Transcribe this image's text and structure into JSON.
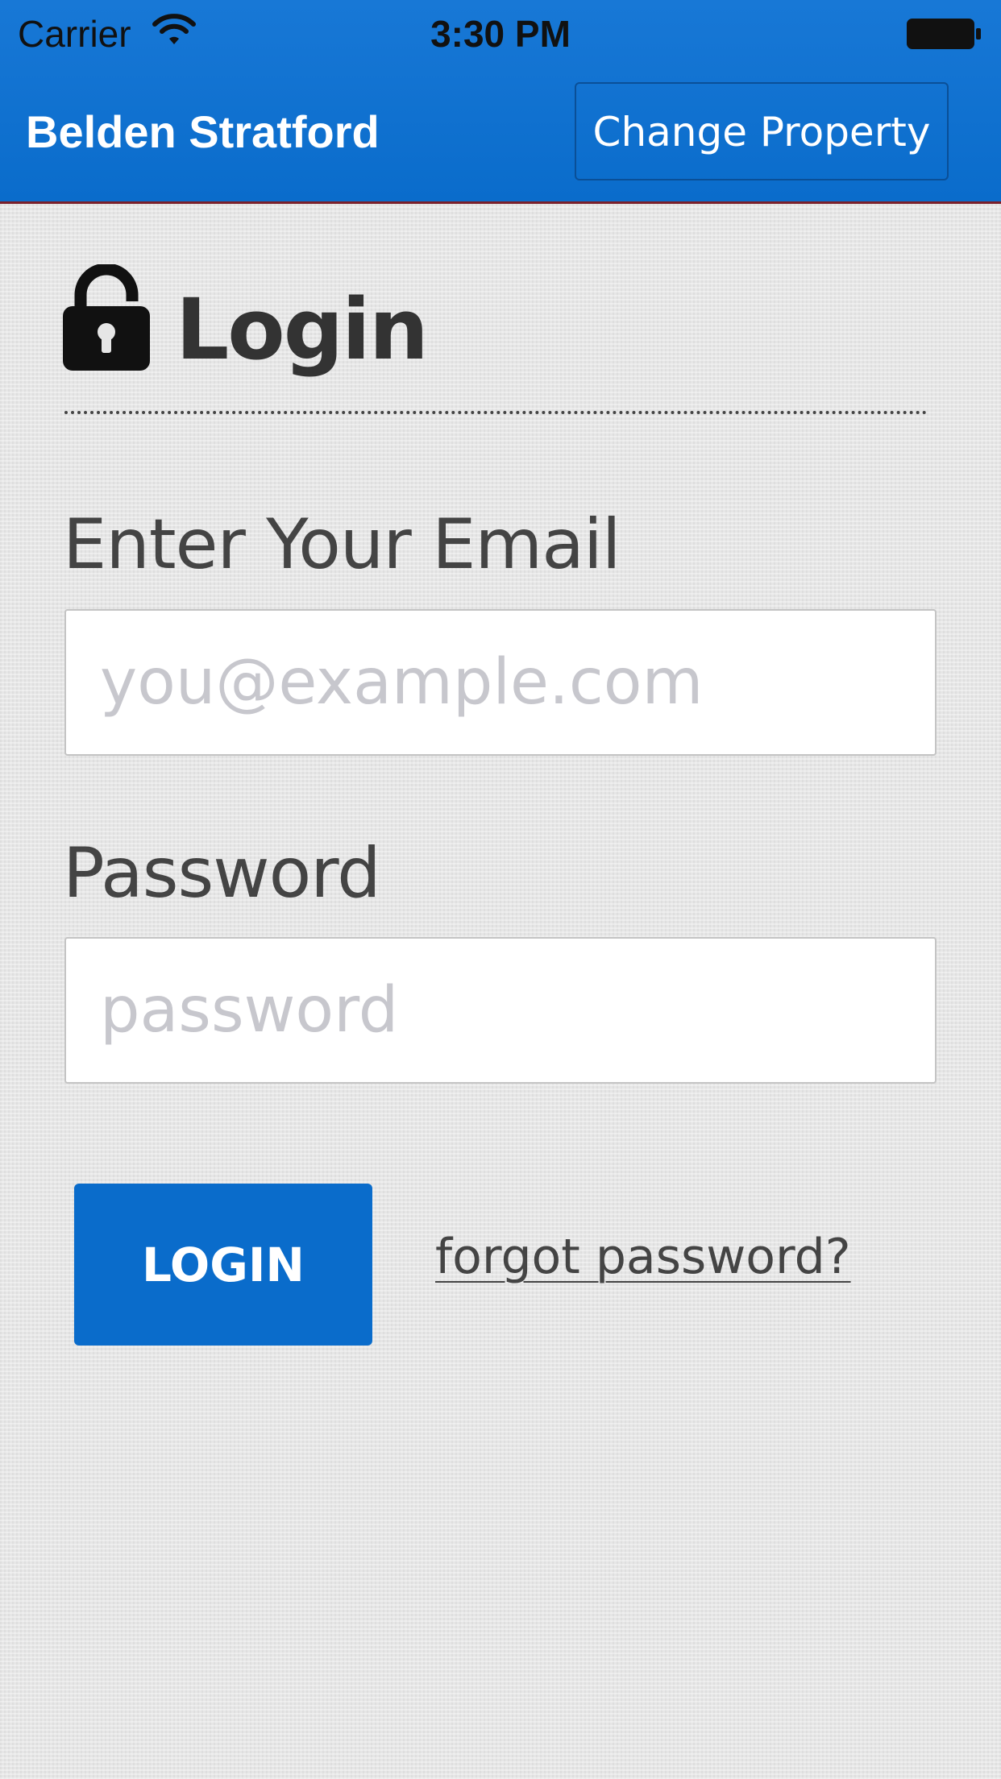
{
  "status_bar": {
    "carrier": "Carrier",
    "time": "3:30 PM",
    "wifi_icon": "wifi-icon",
    "battery_icon": "battery-icon"
  },
  "header": {
    "title": "Belden Stratford",
    "change_property_label": "Change Property",
    "background_color": "#0a6ccb"
  },
  "login": {
    "icon": "unlocked-padlock-icon",
    "title": "Login",
    "email": {
      "label": "Enter Your Email",
      "placeholder": "you@example.com",
      "value": ""
    },
    "password": {
      "label": "Password",
      "placeholder": "password",
      "value": ""
    },
    "submit_label": "LOGIN",
    "forgot_password_label": "forgot password?",
    "accent_color": "#0a6ccb"
  }
}
